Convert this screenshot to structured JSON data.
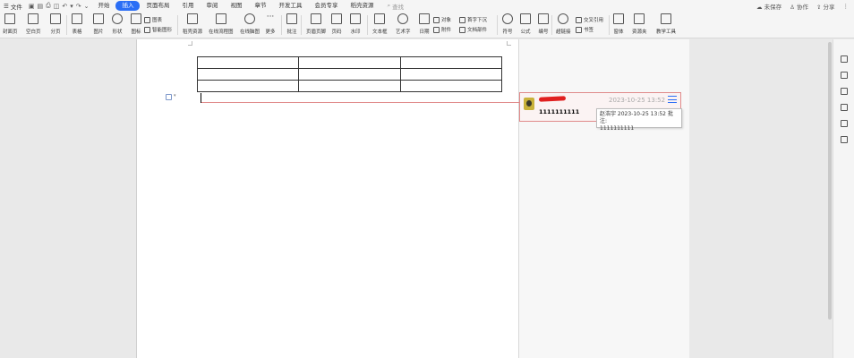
{
  "menubar": {
    "file_label": "文件",
    "tabs": [
      "开始",
      "插入",
      "页面布局",
      "引用",
      "审阅",
      "视图",
      "章节",
      "开发工具",
      "会员专享",
      "稻壳资源"
    ],
    "active_tab": "插入",
    "search_placeholder": "查找",
    "right": {
      "unsaved": "未保存",
      "collab": "协作",
      "share": "分享"
    }
  },
  "ribbon": {
    "cover_page": "封面页",
    "blank_page": "空白页",
    "page_break": "分页",
    "table": "表格",
    "picture": "图片",
    "shape": "形状",
    "icon": "图标",
    "chart": "图表",
    "smart_art": "智能图形",
    "docer_material": "稻壳资源",
    "online_flowchart": "在线流程图",
    "online_mindmap": "在线脑图",
    "more": "更多",
    "comment": "批注",
    "header_footer": "页眉页脚",
    "page_number": "页码",
    "watermark": "水印",
    "textbox": "文本框",
    "wordart": "艺术字",
    "date": "日期",
    "object": "对象",
    "attachment": "附件",
    "dropcap": "首字下沉",
    "doc_parts": "文档部件",
    "symbol": "符号",
    "formula": "公式",
    "numbering": "编号",
    "hyperlink": "超链接",
    "cross_ref": "交叉引用",
    "bookmark": "书签",
    "form": "窗体",
    "resource_folder": "资源夹",
    "teaching_tools": "教学工具"
  },
  "comment": {
    "date": "2023-10-25 13:52",
    "text": "1111111111"
  },
  "tooltip": {
    "line1": "赵浩宇 2023-10-25 13:52 批注:",
    "line2": "1111111111"
  },
  "table": {
    "rows": 3,
    "cols": 3
  }
}
